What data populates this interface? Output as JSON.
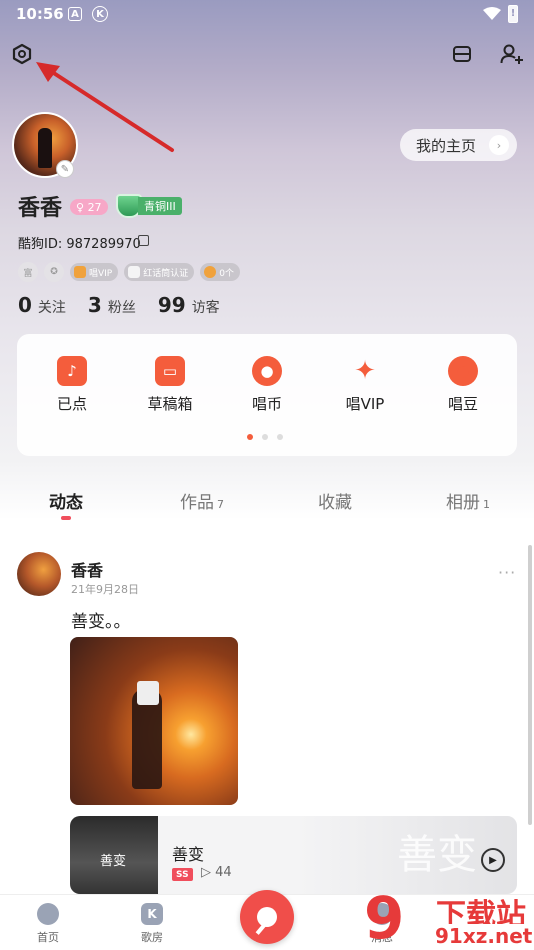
{
  "status_bar": {
    "time": "10:56",
    "icon_a": "A",
    "icon_k": "K",
    "battery": "!"
  },
  "header": {
    "homepage_label": "我的主页"
  },
  "profile": {
    "name": "香香",
    "gender_level": "27",
    "rank_label": "青铜III",
    "id_text": "酷狗ID: 987289970",
    "badges": [
      {
        "type": "circle",
        "text": "富"
      },
      {
        "type": "circle",
        "text": ""
      },
      {
        "type": "pill",
        "text": "唱VIP"
      },
      {
        "type": "pill",
        "text": "红话筒认证"
      },
      {
        "type": "pill",
        "text": "0个"
      }
    ],
    "stats": [
      {
        "value": "0",
        "label": "关注"
      },
      {
        "value": "3",
        "label": "粉丝"
      },
      {
        "value": "99",
        "label": "访客"
      }
    ]
  },
  "quick_items": [
    {
      "label": "已点",
      "icon": "music-note-icon",
      "glyph": "♪"
    },
    {
      "label": "草稿箱",
      "icon": "inbox-icon",
      "glyph": "▭"
    },
    {
      "label": "唱币",
      "icon": "coin-mic-icon",
      "glyph": "●"
    },
    {
      "label": "唱VIP",
      "icon": "vip-icon",
      "glyph": "✦"
    },
    {
      "label": "唱豆",
      "icon": "bean-icon",
      "glyph": "●"
    }
  ],
  "tabs": [
    {
      "label": "动态",
      "count": ""
    },
    {
      "label": "作品",
      "count": "7"
    },
    {
      "label": "收藏",
      "count": ""
    },
    {
      "label": "相册",
      "count": "1"
    }
  ],
  "post": {
    "author": "香香",
    "date": "21年9月28日",
    "more": "···",
    "text": "善变。。",
    "song": {
      "cover_text": "善变",
      "title": "善变",
      "quality": "SS",
      "plays": "▷ 44",
      "watermark": "善变"
    }
  },
  "nav": [
    {
      "label": "首页"
    },
    {
      "label": "歌房",
      "glyph": "K"
    },
    {
      "label": "消息"
    }
  ],
  "watermark": {
    "digit": "9",
    "line1": "下载站",
    "line2": "91xz.net"
  },
  "colors": {
    "accent": "#f45d3c",
    "tab_underline": "#f04e5c",
    "rank_green": "#4ab06a",
    "annotation_arrow": "#d62a2a"
  }
}
